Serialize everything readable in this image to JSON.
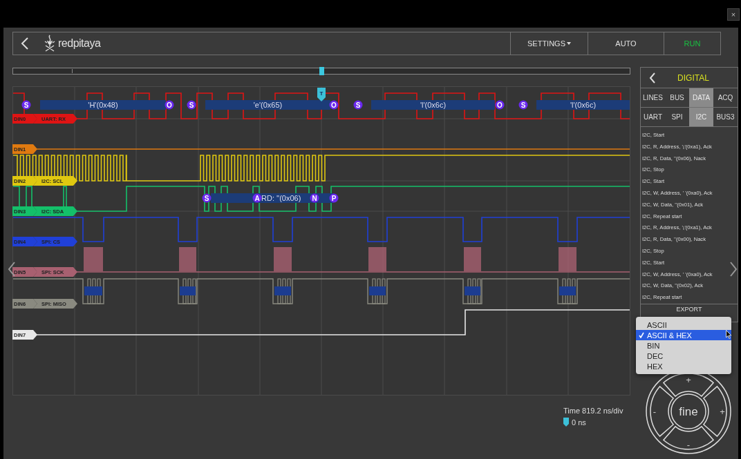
{
  "close": "×",
  "header": {
    "logo_text": "redpitaya",
    "buttons": [
      {
        "label": "SETTINGS",
        "kind": "menu"
      },
      {
        "label": "AUTO",
        "kind": "plain"
      },
      {
        "label": "RUN",
        "kind": "run"
      }
    ]
  },
  "timeline": {
    "level": 0.5
  },
  "trigger": {
    "badge": "T"
  },
  "channels": [
    {
      "name": "DIN0",
      "protocol": "UART: RX",
      "color": "#e01414"
    },
    {
      "name": "DIN1",
      "color": "#e07a10"
    },
    {
      "name": "DIN2",
      "protocol": "I2C: SCL",
      "color": "#e0c810"
    },
    {
      "name": "DIN3",
      "protocol": "I2C: SDA",
      "color": "#14c06a"
    },
    {
      "name": "DIN4",
      "protocol": "SPI: CS",
      "color": "#2040d8"
    },
    {
      "name": "DIN5",
      "protocol": "SPI: SCK",
      "color": "#a86070"
    },
    {
      "name": "DIN6",
      "protocol": "SPI: MISO",
      "color": "#8a8a80"
    },
    {
      "name": "DIN7",
      "color": "#e8e8e8"
    }
  ],
  "uart_decode": [
    {
      "kind": "marker",
      "text": "S"
    },
    {
      "kind": "data",
      "text": "'H'(0x48)"
    },
    {
      "kind": "marker",
      "text": "O"
    },
    {
      "kind": "marker",
      "text": "S"
    },
    {
      "kind": "data",
      "text": "'e'(0x65)"
    },
    {
      "kind": "marker",
      "text": "O"
    },
    {
      "kind": "marker",
      "text": "S"
    },
    {
      "kind": "data",
      "text": "'l'(0x6c)"
    },
    {
      "kind": "marker",
      "text": "O"
    },
    {
      "kind": "marker",
      "text": "S"
    },
    {
      "kind": "data",
      "text": "'l'(0x6c)"
    }
  ],
  "i2c_decode": [
    {
      "kind": "marker",
      "text": "S"
    },
    {
      "kind": "marker",
      "text": "A"
    },
    {
      "kind": "data",
      "text": "RD: ''(0x06)"
    },
    {
      "kind": "marker",
      "text": "N"
    },
    {
      "kind": "marker",
      "text": "P"
    }
  ],
  "panel": {
    "title": "DIGITAL",
    "tabs": [
      {
        "label": "LINES",
        "selected": false
      },
      {
        "label": "BUS",
        "selected": false
      },
      {
        "label": "DATA",
        "selected": true
      },
      {
        "label": "ACQ",
        "selected": false
      }
    ],
    "subtabs": [
      {
        "label": "UART",
        "selected": false
      },
      {
        "label": "SPI",
        "selected": false
      },
      {
        "label": "I2C",
        "selected": true
      },
      {
        "label": "BUS3",
        "selected": false
      }
    ],
    "log": [
      "I2C, Start",
      "I2C, R, Address, '¡'(0xa1), Ack",
      "I2C, R, Data, ''(0x06), Nack",
      "I2C, Stop",
      "I2C, Start",
      "I2C, W, Address, ' '(0xa0), Ack",
      "I2C, W, Data, ''(0x01), Ack",
      "I2C, Repeat start",
      "I2C, R, Address, '¡'(0xa1), Ack",
      "I2C, R, Data, ''(0x00), Nack",
      "I2C, Stop",
      "I2C, Start",
      "I2C, W, Address, ' '(0xa0), Ack",
      "I2C, W, Data, ''(0x02), Ack",
      "I2C, Repeat start"
    ],
    "export": "EXPORT"
  },
  "format_menu": {
    "items": [
      {
        "label": "ASCII",
        "selected": false
      },
      {
        "label": "ASCII & HEX",
        "selected": true
      },
      {
        "label": "BIN",
        "selected": false
      },
      {
        "label": "DEC",
        "selected": false
      },
      {
        "label": "HEX",
        "selected": false
      }
    ]
  },
  "joystick": {
    "up": "+",
    "left": "-",
    "center": "fine",
    "right": "+",
    "down": "-"
  },
  "time": {
    "scale": "Time 819.2 ns/div",
    "trigger_offset": "0 ns"
  }
}
